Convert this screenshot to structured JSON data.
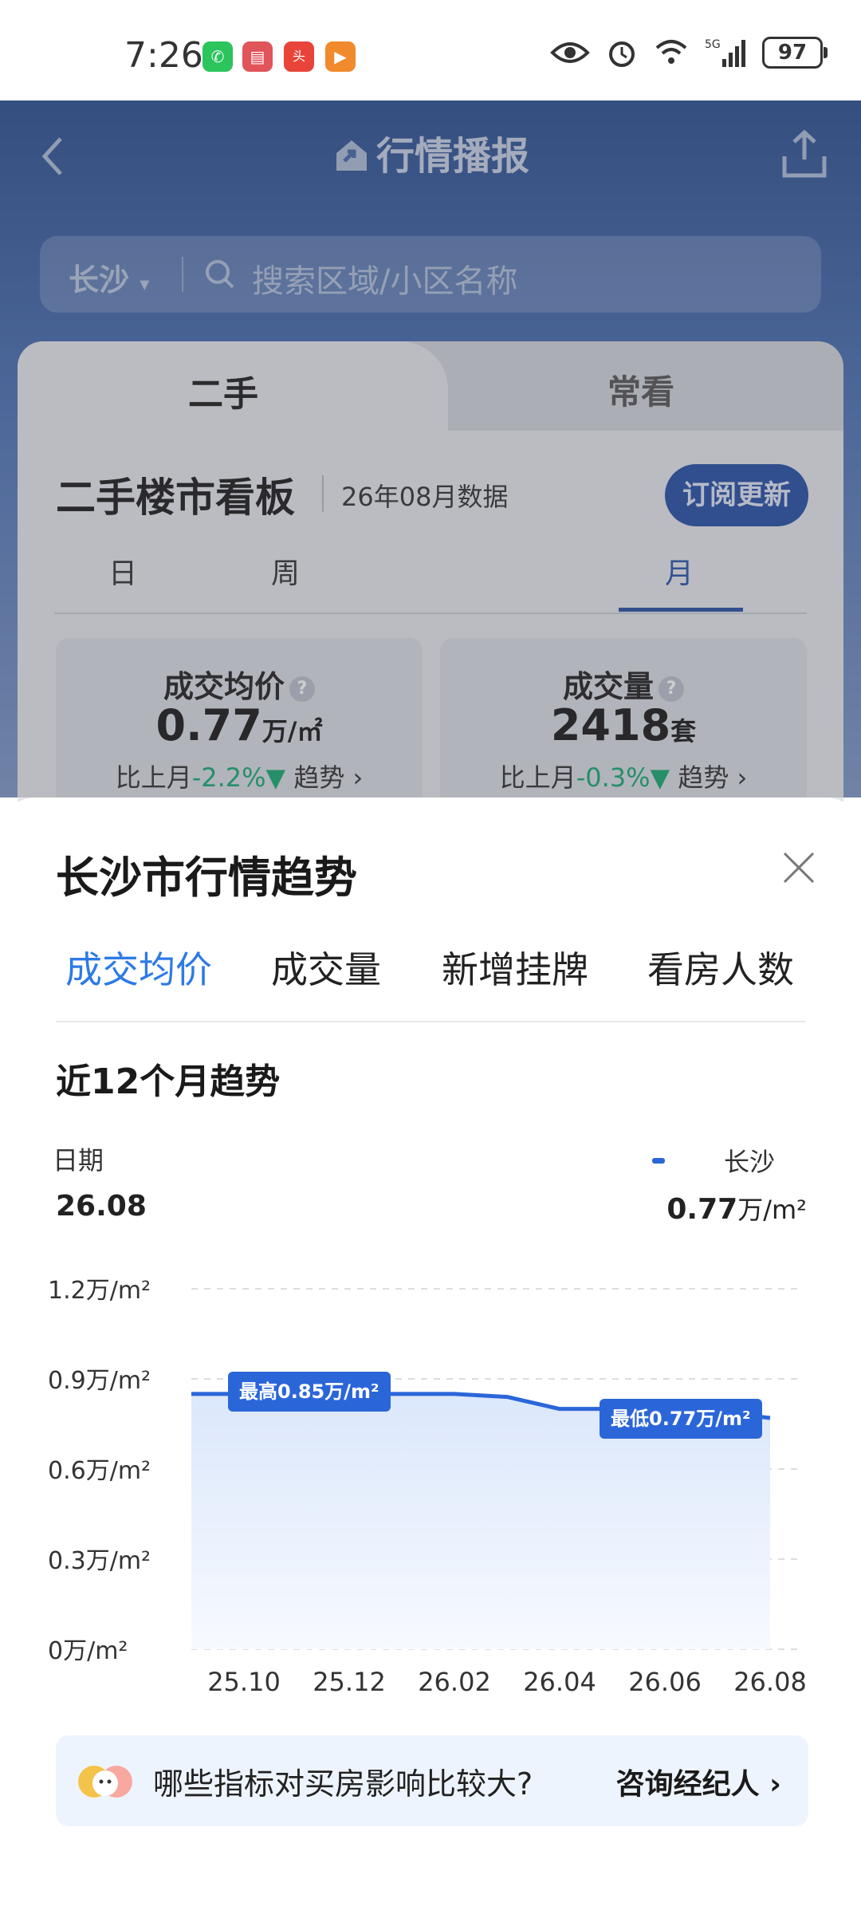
{
  "status_bar": {
    "time": "7:26",
    "battery": "97",
    "network": "5G"
  },
  "header": {
    "title": "行情播报"
  },
  "search": {
    "city": "长沙",
    "placeholder": "搜索区域/小区名称"
  },
  "tabs": {
    "left": "二手",
    "right": "常看"
  },
  "dashboard": {
    "title": "二手楼市看板",
    "data_month": "26年08月数据",
    "subscribe": "订阅更新",
    "periods": [
      "日",
      "周",
      "月"
    ],
    "active_period": "月",
    "stats": [
      {
        "label": "成交均价",
        "value": "0.77",
        "unit": "万/㎡",
        "compare": "比上月",
        "change": "-2.2%▼",
        "trend": "趋势"
      },
      {
        "label": "成交量",
        "value": "2418",
        "unit": "套",
        "compare": "比上月",
        "change": "-0.3%▼",
        "trend": "趋势"
      }
    ]
  },
  "sheet": {
    "title": "长沙市行情趋势",
    "tabs": [
      "成交均价",
      "成交量",
      "新增挂牌",
      "看房人数"
    ],
    "active_tab": "成交均价",
    "subtitle": "近12个月趋势",
    "date_label": "日期",
    "date_value": "26.08",
    "legend_city": "长沙",
    "legend_value": "0.77",
    "legend_unit": "万/m²",
    "banner_question": "哪些指标对买房影响比较大?",
    "banner_cta": "咨询经纪人"
  },
  "chart_data": {
    "type": "area",
    "x": [
      "25.09",
      "25.10",
      "25.11",
      "25.12",
      "26.01",
      "26.02",
      "26.03",
      "26.04",
      "26.05",
      "26.06",
      "26.07",
      "26.08"
    ],
    "x_tick_labels": [
      "25.10",
      "25.12",
      "26.02",
      "26.04",
      "26.06",
      "26.08"
    ],
    "series": [
      {
        "name": "长沙",
        "values": [
          0.85,
          0.85,
          0.85,
          0.85,
          0.85,
          0.85,
          0.84,
          0.8,
          0.8,
          0.79,
          0.79,
          0.77
        ]
      }
    ],
    "y_ticks": [
      "1.2万/m²",
      "0.9万/m²",
      "0.6万/m²",
      "0.3万/m²",
      "0万/m²"
    ],
    "ylim": [
      0,
      1.2
    ],
    "annotations": [
      {
        "label": "最高0.85万/m²",
        "index": 1
      },
      {
        "label": "最低0.77万/m²",
        "index": 11
      }
    ],
    "color": "#2b66d9",
    "grid": true
  }
}
